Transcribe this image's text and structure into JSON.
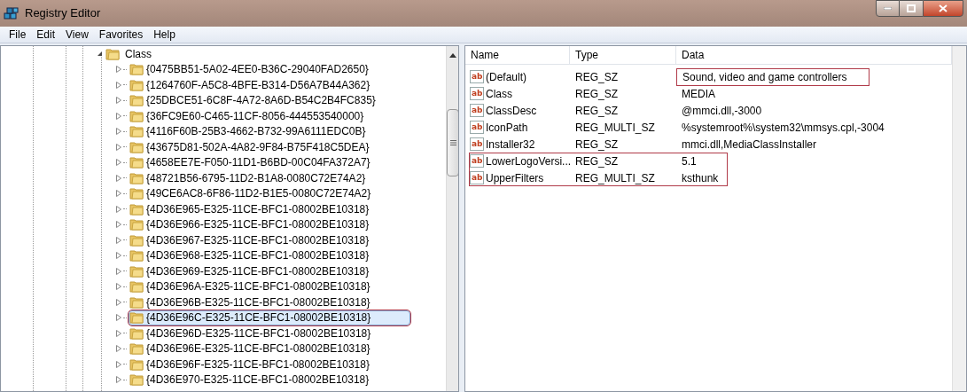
{
  "window": {
    "title": "Registry Editor"
  },
  "menu": [
    "File",
    "Edit",
    "View",
    "Favorites",
    "Help"
  ],
  "tree": {
    "label": "Class",
    "expanded": true,
    "children": [
      {
        "label": "{0475BB51-5A02-4EE0-B36C-29040FAD2650}",
        "selected": false,
        "marked": false
      },
      {
        "label": "{1264760F-A5C8-4BFE-B314-D56A7B44A362}",
        "selected": false,
        "marked": false
      },
      {
        "label": "{25DBCE51-6C8F-4A72-8A6D-B54C2B4FC835}",
        "selected": false,
        "marked": false
      },
      {
        "label": "{36FC9E60-C465-11CF-8056-444553540000}",
        "selected": false,
        "marked": false
      },
      {
        "label": "{4116F60B-25B3-4662-B732-99A6111EDC0B}",
        "selected": false,
        "marked": false
      },
      {
        "label": "{43675D81-502A-4A82-9F84-B75F418C5DEA}",
        "selected": false,
        "marked": false
      },
      {
        "label": "{4658EE7E-F050-11D1-B6BD-00C04FA372A7}",
        "selected": false,
        "marked": false
      },
      {
        "label": "{48721B56-6795-11D2-B1A8-0080C72E74A2}",
        "selected": false,
        "marked": false
      },
      {
        "label": "{49CE6AC8-6F86-11D2-B1E5-0080C72E74A2}",
        "selected": false,
        "marked": false
      },
      {
        "label": "{4D36E965-E325-11CE-BFC1-08002BE10318}",
        "selected": false,
        "marked": false
      },
      {
        "label": "{4D36E966-E325-11CE-BFC1-08002BE10318}",
        "selected": false,
        "marked": false
      },
      {
        "label": "{4D36E967-E325-11CE-BFC1-08002BE10318}",
        "selected": false,
        "marked": false
      },
      {
        "label": "{4D36E968-E325-11CE-BFC1-08002BE10318}",
        "selected": false,
        "marked": false
      },
      {
        "label": "{4D36E969-E325-11CE-BFC1-08002BE10318}",
        "selected": false,
        "marked": false
      },
      {
        "label": "{4D36E96A-E325-11CE-BFC1-08002BE10318}",
        "selected": false,
        "marked": false
      },
      {
        "label": "{4D36E96B-E325-11CE-BFC1-08002BE10318}",
        "selected": false,
        "marked": false
      },
      {
        "label": "{4D36E96C-E325-11CE-BFC1-08002BE10318}",
        "selected": true,
        "marked": true
      },
      {
        "label": "{4D36E96D-E325-11CE-BFC1-08002BE10318}",
        "selected": false,
        "marked": false
      },
      {
        "label": "{4D36E96E-E325-11CE-BFC1-08002BE10318}",
        "selected": false,
        "marked": false
      },
      {
        "label": "{4D36E96F-E325-11CE-BFC1-08002BE10318}",
        "selected": false,
        "marked": false
      },
      {
        "label": "{4D36E970-E325-11CE-BFC1-08002BE10318}",
        "selected": false,
        "marked": false
      }
    ]
  },
  "values": {
    "columns": [
      "Name",
      "Type",
      "Data"
    ],
    "rows": [
      {
        "icon": "ab",
        "name": "(Default)",
        "type": "REG_SZ",
        "data": "Sound, video and game controllers",
        "data_marked": true,
        "row_marked": false
      },
      {
        "icon": "ab",
        "name": "Class",
        "type": "REG_SZ",
        "data": "MEDIA",
        "data_marked": false,
        "row_marked": false
      },
      {
        "icon": "ab",
        "name": "ClassDesc",
        "type": "REG_SZ",
        "data": "@mmci.dll,-3000",
        "data_marked": false,
        "row_marked": false
      },
      {
        "icon": "ab",
        "name": "IconPath",
        "type": "REG_MULTI_SZ",
        "data": "%systemroot%\\system32\\mmsys.cpl,-3004",
        "data_marked": false,
        "row_marked": false
      },
      {
        "icon": "ab",
        "name": "Installer32",
        "type": "REG_SZ",
        "data": "mmci.dll,MediaClassInstaller",
        "data_marked": false,
        "row_marked": false
      },
      {
        "icon": "ab",
        "name": "LowerLogoVersi...",
        "type": "REG_SZ",
        "data": "5.1",
        "data_marked": false,
        "row_marked": true
      },
      {
        "icon": "ab",
        "name": "UpperFilters",
        "type": "REG_MULTI_SZ",
        "data": "ksthunk",
        "data_marked": false,
        "row_marked": true
      }
    ]
  }
}
